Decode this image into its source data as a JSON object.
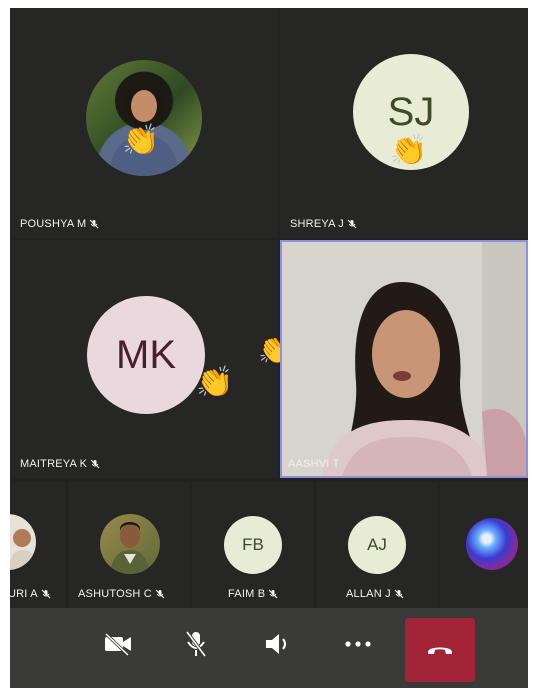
{
  "participants": {
    "poushya": {
      "name": "POUSHYA M"
    },
    "shreya": {
      "name": "SHREYA J",
      "initials": "SJ"
    },
    "maitreya": {
      "name": "MAITREYA K",
      "initials": "MK"
    },
    "aashvi": {
      "name": "AASHVI T"
    }
  },
  "strip": [
    {
      "name": "URI A"
    },
    {
      "name": "ASHUTOSH C"
    },
    {
      "name": "FAIM B",
      "initials": "FB"
    },
    {
      "name": "ALLAN J",
      "initials": "AJ"
    },
    {
      "name": ""
    }
  ],
  "reaction": {
    "emoji": "👏"
  },
  "colors": {
    "background": "#222220",
    "tile": "#262625",
    "speaker_border": "#8f8ee0",
    "end_call": "#a42437",
    "avatar_light": "#e8ecd4",
    "avatar_pink": "#e9d9df"
  },
  "controls": {
    "camera": "camera-off-icon",
    "mic": "mic-off-icon",
    "speaker": "speaker-icon",
    "more": "more-options-icon",
    "end": "end-call-icon"
  }
}
